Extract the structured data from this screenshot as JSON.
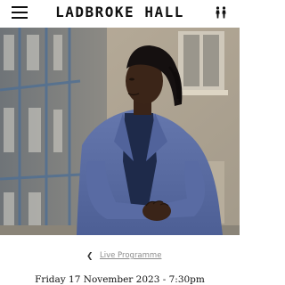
{
  "header": {
    "brand": "LADBROKE HALL",
    "menu_icon": "hamburger-menu-icon",
    "people_icon": "people-icon"
  },
  "hero": {
    "image_description_icon": "hero-photo"
  },
  "navigation": {
    "back_icon": "chevron-left-icon",
    "back_label": "Live Programme"
  },
  "event": {
    "date": "Friday 17 November 2023 - 7:30pm"
  },
  "colors": {
    "text": "#111111",
    "link_muted": "#8d8d8d",
    "suit": "#5b6fa8",
    "background": "#ffffff"
  }
}
